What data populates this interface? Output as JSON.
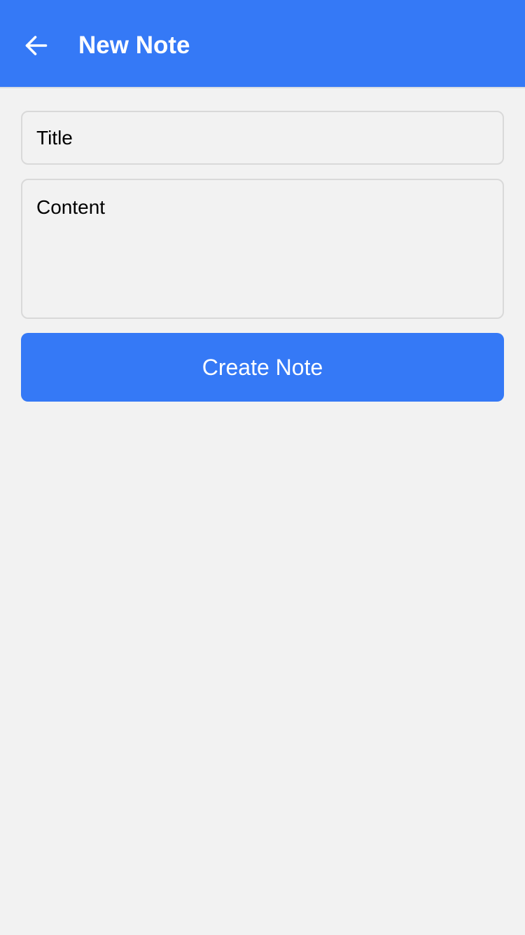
{
  "header": {
    "title": "New Note",
    "back_icon": "arrow-left-icon",
    "background_color": "#3579f6"
  },
  "form": {
    "title_placeholder": "Title",
    "title_value": "",
    "content_placeholder": "Content",
    "content_value": "",
    "submit_label": "Create Note"
  },
  "colors": {
    "accent": "#3579f6",
    "background": "#f2f2f2",
    "border": "#d9d9d9"
  }
}
